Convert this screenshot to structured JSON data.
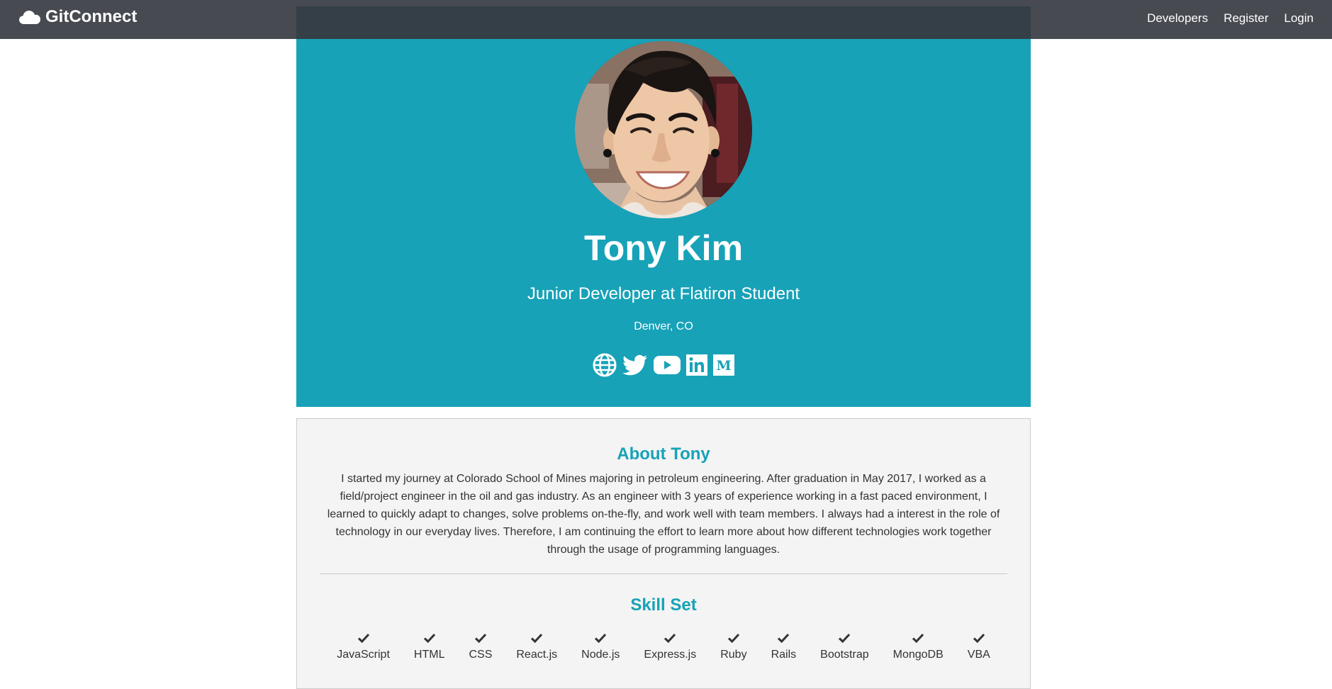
{
  "navbar": {
    "brand": "GitConnect",
    "links": [
      "Developers",
      "Register",
      "Login"
    ]
  },
  "profile": {
    "name": "Tony Kim",
    "headline": "Junior Developer at Flatiron Student",
    "location": "Denver, CO",
    "socials": [
      "globe-icon",
      "twitter-icon",
      "youtube-icon",
      "linkedin-icon",
      "medium-icon"
    ]
  },
  "about": {
    "title": "About Tony",
    "text": "I started my journey at Colorado School of Mines majoring in petroleum engineering. After graduation in May 2017, I worked as a field/project engineer in the oil and gas industry. As an engineer with 3 years of experience working in a fast paced environment, I learned to quickly adapt to changes, solve problems on-the-fly, and work well with team members. I always had a interest in the role of technology in our everyday lives. Therefore, I am continuing the effort to learn more about how different technologies work together through the usage of programming languages."
  },
  "skills": {
    "title": "Skill Set",
    "items": [
      "JavaScript",
      "HTML",
      "CSS",
      "React.js",
      "Node.js",
      "Express.js",
      "Ruby",
      "Rails",
      "Bootstrap",
      "MongoDB",
      "VBA"
    ]
  },
  "colors": {
    "navbar": "#474b51",
    "accent": "#17a2b8",
    "panel": "#f4f4f4"
  }
}
